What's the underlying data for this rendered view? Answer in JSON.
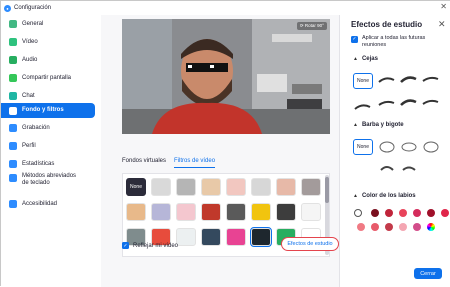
{
  "window": {
    "title": "Configuración",
    "close_glyph": "✕",
    "logo_glyph": "●"
  },
  "sidebar": {
    "items": [
      {
        "label": "General",
        "icon": "gear-icon",
        "color": "#42b883"
      },
      {
        "label": "Vídeo",
        "icon": "video-icon",
        "color": "#2ec27e"
      },
      {
        "label": "Audio",
        "icon": "headphones-icon",
        "color": "#27ae60"
      },
      {
        "label": "Compartir pantalla",
        "icon": "share-screen-icon",
        "color": "#34c759"
      },
      {
        "label": "Chat",
        "icon": "chat-icon",
        "color": "#1fb6a3"
      },
      {
        "label": "Fondo y filtros",
        "icon": "background-icon",
        "color": "#ffffff"
      },
      {
        "label": "Grabación",
        "icon": "record-icon",
        "color": "#2d8cff"
      },
      {
        "label": "Perfil",
        "icon": "profile-icon",
        "color": "#2d8cff"
      },
      {
        "label": "Estadísticas",
        "icon": "stats-icon",
        "color": "#2d8cff"
      },
      {
        "label": "Métodos abreviados de teclado",
        "icon": "keyboard-icon",
        "color": "#2d8cff"
      },
      {
        "label": "Accesibilidad",
        "icon": "accessibility-icon",
        "color": "#2d8cff"
      }
    ],
    "active_index": 5
  },
  "preview": {
    "rotate_label": "⟳ Rotar 90°"
  },
  "tabs": [
    {
      "label": "Fondos virtuales"
    },
    {
      "label": "Filtros de vídeo"
    }
  ],
  "active_tab": 1,
  "filters": {
    "none_label": "None",
    "row1": [
      "#2b2b3a",
      "#d9d9d9",
      "#b5b5b5",
      "#e8c9a8",
      "#f2c7c0",
      "#d7d7d7",
      "#e7b9a8",
      "#a39b9b"
    ],
    "row2": [
      "#e8b98a",
      "#b6b6d8",
      "#f4c7cf",
      "#c0392b",
      "#5a5a5a",
      "#f1c40f",
      "#3d3d3d",
      "#f5f5f5"
    ],
    "row3": [
      "#7f8c8d",
      "#e74c3c",
      "#ecf0f1",
      "#34495e",
      "#e84393",
      "#1e272e",
      "#27ae60",
      "#ffffff"
    ]
  },
  "mirror_label": "Reflejar mi vídeo",
  "check_glyph": "✓",
  "studio_button": "Efectos de estudio",
  "panel": {
    "title": "Efectos de estudio",
    "close_glyph": "✕",
    "apply_label": "Aplicar a todas las futuras reuniones",
    "sections": [
      {
        "label": "Cejas",
        "chevron": "▲"
      },
      {
        "label": "Barba y bigote",
        "chevron": "▲"
      },
      {
        "label": "Color de los labios",
        "chevron": "▲"
      }
    ],
    "none_label": "None",
    "lip_colors_row1": [
      "#7a0f1e",
      "#c0243a",
      "#e8435a",
      "#d42c5c",
      "#a0102a",
      "#e0254a"
    ],
    "lip_colors_row2": [
      "#f07a84",
      "#e85a6a",
      "#c33a4a",
      "#f4a6b2",
      "#d34d8a"
    ],
    "close_button": "Cerrar"
  }
}
